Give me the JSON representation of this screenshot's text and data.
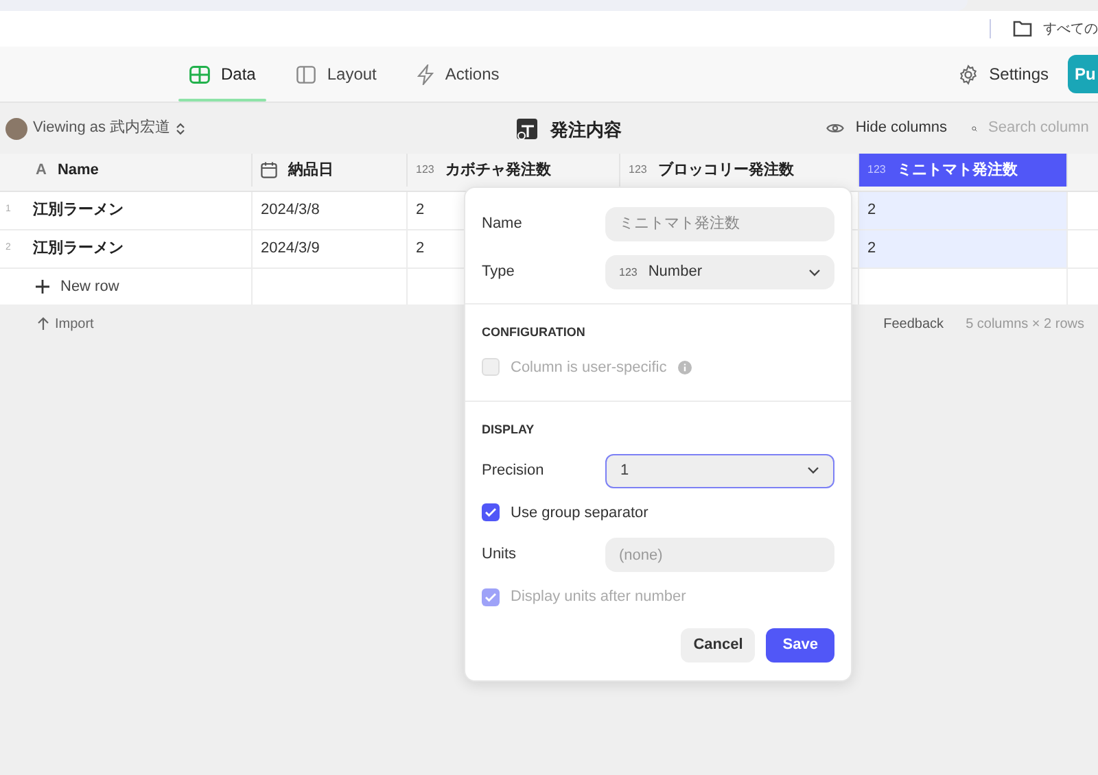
{
  "top_bar": {
    "folder_label": "すべての"
  },
  "nav_tabs": [
    {
      "label": "Data",
      "kind": "data",
      "selected": true
    },
    {
      "label": "Layout",
      "kind": "layout",
      "selected": false
    },
    {
      "label": "Actions",
      "kind": "actions",
      "selected": false
    }
  ],
  "settings": "Settings",
  "publish_button": "Pu",
  "toolbar": {
    "viewing_as": "Viewing as 武内宏道",
    "title": "発注内容",
    "hide_columns": "Hide columns",
    "search_placeholder": "Search column"
  },
  "table": {
    "columns": [
      {
        "label": "Name",
        "kind": "text",
        "glyph": "A",
        "selected": false
      },
      {
        "label": "納品日",
        "kind": "date",
        "selected": false
      },
      {
        "label": "カボチャ発注数",
        "kind": "number",
        "glyph": "123",
        "selected": false
      },
      {
        "label": "ブロッコリー発注数",
        "kind": "number",
        "glyph": "123",
        "selected": false
      },
      {
        "label": "ミニトマト発注数",
        "kind": "number",
        "glyph": "123",
        "selected": true
      }
    ],
    "rows": [
      {
        "number": "1",
        "cells": [
          "江別ラーメン",
          "2024/3/8",
          "2",
          null,
          "2"
        ]
      },
      {
        "number": "2",
        "cells": [
          "江別ラーメン",
          "2024/3/9",
          "2",
          null,
          "2"
        ]
      }
    ],
    "new_row": "New row"
  },
  "footer": {
    "import": "Import",
    "feedback": "Feedback",
    "summary": "5 columns × 2 rows"
  },
  "popup": {
    "name_label": "Name",
    "name_value": "ミニトマト発注数",
    "type_label": "Type",
    "type_glyph": "123",
    "type_value": "Number",
    "configuration_heading": "CONFIGURATION",
    "user_specific": {
      "label": "Column is user-specific",
      "checked": false,
      "disabled": true
    },
    "display_heading": "DISPLAY",
    "precision_label": "Precision",
    "precision_value": "1",
    "group_separator": {
      "label": "Use group separator",
      "checked": true,
      "disabled": false
    },
    "units_label": "Units",
    "units_placeholder": "(none)",
    "units_after": {
      "label": "Display units after number",
      "checked": true,
      "disabled": true
    },
    "cancel": "Cancel",
    "save": "Save"
  }
}
